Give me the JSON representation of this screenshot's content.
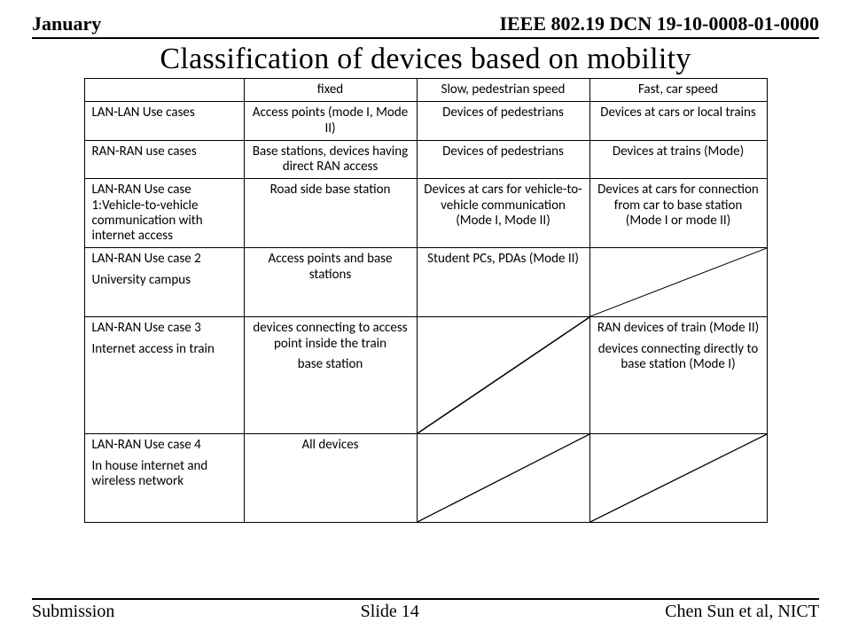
{
  "header": {
    "left": "January",
    "right": "IEEE 802.19 DCN 19-10-0008-01-0000"
  },
  "title": "Classification of devices based on mobility",
  "footer": {
    "left": "Submission",
    "center": "Slide 14",
    "right": "Chen Sun et al, NICT"
  },
  "table": {
    "head": {
      "c1": "",
      "c2": "fixed",
      "c3": "Slow, pedestrian speed",
      "c4": "Fast, car speed"
    },
    "rows": [
      {
        "c1_a": "LAN-LAN Use cases",
        "c1_b": "",
        "c2": "Access points (mode I, Mode II)",
        "c3": "Devices of pedestrians",
        "c4": "Devices at cars or local trains"
      },
      {
        "c1_a": "RAN-RAN use cases",
        "c1_b": "",
        "c2": "Base stations, devices having direct RAN access",
        "c3": "Devices of pedestrians",
        "c4": "Devices at trains (Mode)"
      },
      {
        "c1_a": "LAN-RAN Use case 1:Vehicle-to-vehicle communication with internet access",
        "c1_b": "",
        "c2": "Road side base station",
        "c3": "Devices at cars for vehicle-to-vehicle communication (Mode I, Mode II)",
        "c4": "Devices at cars for connection from car to base station (Mode I or mode II)"
      },
      {
        "c1_a": "LAN-RAN Use case 2",
        "c1_b": "University campus",
        "c2": "Access points and base stations",
        "c3": "Student PCs, PDAs (Mode II)",
        "c4": ""
      },
      {
        "c1_a": "LAN-RAN Use case 3",
        "c1_b": "Internet access in train",
        "c2_a": "devices connecting to access point inside the train",
        "c2_b": "base station",
        "c3": "",
        "c4_a": "RAN devices of train (Mode II)",
        "c4_b": "devices connecting directly to base station (Mode I)"
      },
      {
        "c1_a": "LAN-RAN Use case 4",
        "c1_b": "In house internet and wireless network",
        "c2": "All devices",
        "c3": "",
        "c4": ""
      }
    ]
  }
}
